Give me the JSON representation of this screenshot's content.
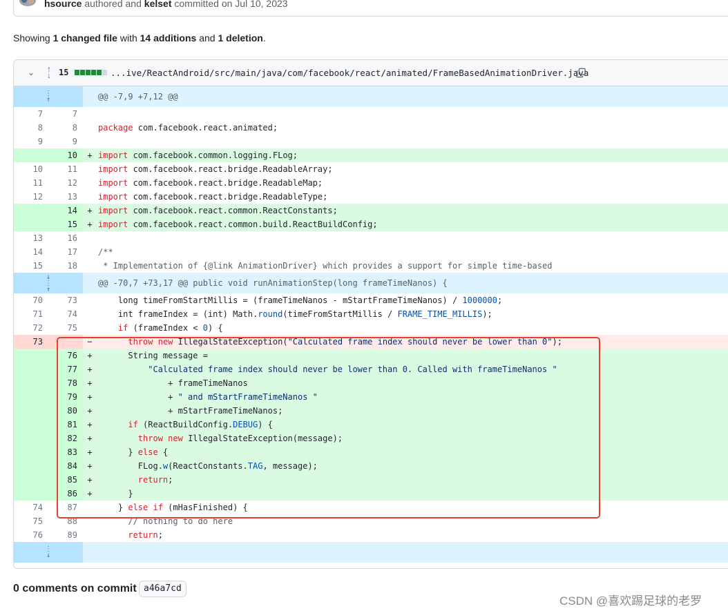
{
  "commit": {
    "author": "hsource",
    "authored_text": "authored and",
    "committer": "kelset",
    "committed_text": "committed on Jul 10, 2023"
  },
  "summary": {
    "prefix": "Showing",
    "changed": "1 changed file",
    "with": "with",
    "additions": "14 additions",
    "and": "and",
    "deletions": "1 deletion",
    "suffix": "."
  },
  "file": {
    "change_count": "15",
    "diffstat": {
      "added": 5,
      "neutral": 1
    },
    "path": "...ive/ReactAndroid/src/main/java/com/facebook/react/animated/FrameBasedAnimationDriver.java"
  },
  "diff_rows": [
    {
      "type": "hunk",
      "text": "@@ -7,9 +7,12 @@"
    },
    {
      "type": "ctx",
      "old": "7",
      "new": "7",
      "text": ""
    },
    {
      "type": "ctx",
      "old": "8",
      "new": "8",
      "text": "package com.facebook.react.animated;"
    },
    {
      "type": "ctx",
      "old": "9",
      "new": "9",
      "text": ""
    },
    {
      "type": "add",
      "old": "",
      "new": "10",
      "text": "import com.facebook.common.logging.FLog;"
    },
    {
      "type": "ctx",
      "old": "10",
      "new": "11",
      "text": "import com.facebook.react.bridge.ReadableArray;"
    },
    {
      "type": "ctx",
      "old": "11",
      "new": "12",
      "text": "import com.facebook.react.bridge.ReadableMap;"
    },
    {
      "type": "ctx",
      "old": "12",
      "new": "13",
      "text": "import com.facebook.react.bridge.ReadableType;"
    },
    {
      "type": "add",
      "old": "",
      "new": "14",
      "text": "import com.facebook.react.common.ReactConstants;"
    },
    {
      "type": "add",
      "old": "",
      "new": "15",
      "text": "import com.facebook.react.common.build.ReactBuildConfig;"
    },
    {
      "type": "ctx",
      "old": "13",
      "new": "16",
      "text": ""
    },
    {
      "type": "ctx",
      "old": "14",
      "new": "17",
      "text": "/**"
    },
    {
      "type": "ctx",
      "old": "15",
      "new": "18",
      "text": " * Implementation of {@link AnimationDriver} which provides a support for simple time-based"
    },
    {
      "type": "hunk",
      "text": "@@ -70,7 +73,17 @@ public void runAnimationStep(long frameTimeNanos) {"
    },
    {
      "type": "ctx",
      "old": "70",
      "new": "73",
      "text": "    long timeFromStartMillis = (frameTimeNanos - mStartFrameTimeNanos) / 1000000;"
    },
    {
      "type": "ctx",
      "old": "71",
      "new": "74",
      "text": "    int frameIndex = (int) Math.round(timeFromStartMillis / FRAME_TIME_MILLIS);"
    },
    {
      "type": "ctx",
      "old": "72",
      "new": "75",
      "text": "    if (frameIndex < 0) {"
    },
    {
      "type": "del",
      "old": "73",
      "new": "",
      "text": "      throw new IllegalStateException(\"Calculated frame index should never be lower than 0\");"
    },
    {
      "type": "add",
      "old": "",
      "new": "76",
      "text": "      String message ="
    },
    {
      "type": "add",
      "old": "",
      "new": "77",
      "text": "          \"Calculated frame index should never be lower than 0. Called with frameTimeNanos \""
    },
    {
      "type": "add",
      "old": "",
      "new": "78",
      "text": "              + frameTimeNanos"
    },
    {
      "type": "add",
      "old": "",
      "new": "79",
      "text": "              + \" and mStartFrameTimeNanos \""
    },
    {
      "type": "add",
      "old": "",
      "new": "80",
      "text": "              + mStartFrameTimeNanos;"
    },
    {
      "type": "add",
      "old": "",
      "new": "81",
      "text": "      if (ReactBuildConfig.DEBUG) {"
    },
    {
      "type": "add",
      "old": "",
      "new": "82",
      "text": "        throw new IllegalStateException(message);"
    },
    {
      "type": "add",
      "old": "",
      "new": "83",
      "text": "      } else {"
    },
    {
      "type": "add",
      "old": "",
      "new": "84",
      "text": "        FLog.w(ReactConstants.TAG, message);"
    },
    {
      "type": "add",
      "old": "",
      "new": "85",
      "text": "        return;"
    },
    {
      "type": "add",
      "old": "",
      "new": "86",
      "text": "      }"
    },
    {
      "type": "ctx",
      "old": "74",
      "new": "87",
      "text": "    } else if (mHasFinished) {"
    },
    {
      "type": "ctx",
      "old": "75",
      "new": "88",
      "text": "      // nothing to do here"
    },
    {
      "type": "ctx",
      "old": "76",
      "new": "89",
      "text": "      return;"
    },
    {
      "type": "hunk",
      "text": ""
    }
  ],
  "comments": {
    "label": "0 comments on commit",
    "sha": "a46a7cd"
  },
  "watermark": "CSDN @喜欢踢足球的老罗",
  "colors": {
    "add_bg": "#dafbe1",
    "del_bg": "#ffebe9",
    "hunk_bg": "#ddf4ff",
    "highlight_box": "#e4412f"
  }
}
